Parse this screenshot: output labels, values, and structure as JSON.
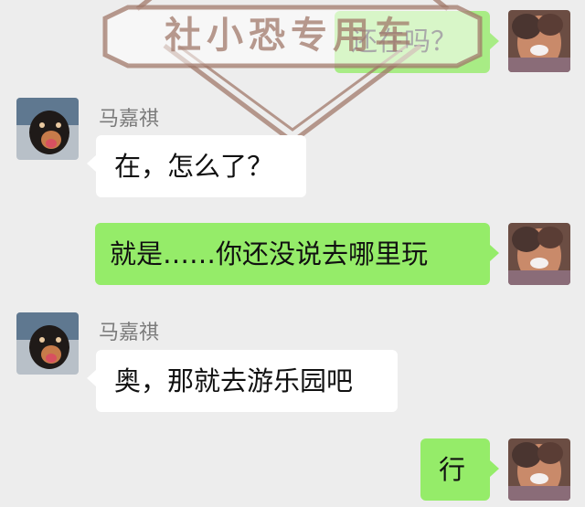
{
  "watermark": {
    "text": "社小恐专用车"
  },
  "contact": {
    "name": "马嘉祺"
  },
  "messages": [
    {
      "from": "self",
      "text": "还在吗？"
    },
    {
      "from": "contact",
      "sender": "马嘉祺",
      "text": "在，怎么了？"
    },
    {
      "from": "self",
      "text": "就是……你还没说去哪里玩"
    },
    {
      "from": "contact",
      "sender": "马嘉祺",
      "text": "奥，那就去游乐园吧"
    },
    {
      "from": "self",
      "text": "行"
    }
  ],
  "colors": {
    "background": "#ededed",
    "self_bubble": "#95ec69",
    "contact_bubble": "#ffffff",
    "watermark": "#a07869"
  }
}
